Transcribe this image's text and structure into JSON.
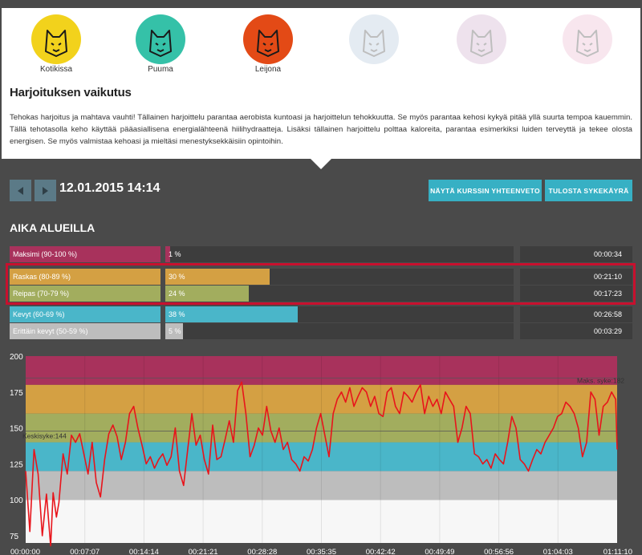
{
  "animals": [
    {
      "label": "Kotikissa",
      "color": "#f2d21c",
      "icon": "cat-icon"
    },
    {
      "label": "Puuma",
      "color": "#35c1a8",
      "icon": "puma-icon"
    },
    {
      "label": "Leijona",
      "color": "#e34a16",
      "icon": "lion-icon"
    },
    {
      "label": "",
      "color": "#9fb8d1",
      "icon": "leopard-icon"
    },
    {
      "label": "",
      "color": "#c69ac0",
      "icon": "tiger-icon"
    },
    {
      "label": "",
      "color": "#e8a7c6",
      "icon": "panther-icon"
    }
  ],
  "effect": {
    "title": "Harjoituksen vaikutus",
    "body": "Tehokas harjoitus ja mahtava vauhti! Tällainen harjoittelu parantaa aerobista kuntoasi ja harjoittelun tehokkuutta. Se myös parantaa kehosi kykyä pitää yllä suurta tempoa kauemmin. Tällä tehotasolla keho käyttää pääasiallisena energialähteenä hiilihydraatteja. Lisäksi tällainen harjoittelu polttaa kaloreita, parantaa esimerkiksi luiden terveyttä ja tekee olosta energisen. Se myös valmistaa kehoasi ja mieltäsi menestyksekkäisiin opintoihin."
  },
  "toolbar": {
    "date": "12.01.2015 14:14",
    "summary_label": "NÄYTÄ KURSSIN YHTEENVETO",
    "print_label": "TULOSTA SYKEKÄYRÄ"
  },
  "zones_title": "AIKA ALUEILLA",
  "zones": [
    {
      "name": "Maksimi (90-100 %)",
      "pct": "1 %",
      "fraction": 0.01,
      "time": "00:00:34",
      "color": "#a8325c"
    },
    {
      "name": "Raskas (80-89 %)",
      "pct": "30 %",
      "fraction": 0.3,
      "time": "00:21:10",
      "color": "#d4a043"
    },
    {
      "name": "Reipas (70-79 %)",
      "pct": "24 %",
      "fraction": 0.24,
      "time": "00:17:23",
      "color": "#a2ad5e"
    },
    {
      "name": "Kevyt (60-69 %)",
      "pct": "38 %",
      "fraction": 0.38,
      "time": "00:26:58",
      "color": "#4ab6c9"
    },
    {
      "name": "Erittäin kevyt (50-59 %)",
      "pct": "5 %",
      "fraction": 0.05,
      "time": "00:03:29",
      "color": "#bdbdbd"
    }
  ],
  "chart_data": {
    "type": "line",
    "title": "",
    "xlabel": "",
    "ylabel": "",
    "ylim": [
      70,
      200
    ],
    "y_ticks": [
      "200",
      "175",
      "150",
      "125",
      "100",
      "75"
    ],
    "x_ticks": [
      "00:00:00",
      "00:07:07",
      "00:14:14",
      "00:21:21",
      "00:28:28",
      "00:35:35",
      "00:42:42",
      "00:49:49",
      "00:56:56",
      "01:04:03",
      "01:11:10"
    ],
    "bands": [
      {
        "from": 180,
        "to": 200,
        "color": "#a8325c"
      },
      {
        "from": 160,
        "to": 180,
        "color": "#d4a043"
      },
      {
        "from": 140,
        "to": 160,
        "color": "#a2ad5e"
      },
      {
        "from": 120,
        "to": 140,
        "color": "#4ab6c9"
      },
      {
        "from": 100,
        "to": 120,
        "color": "#bdbdbd"
      },
      {
        "from": 70,
        "to": 100,
        "color": "#f7f7f7"
      }
    ],
    "max_line": {
      "value": 182,
      "label": "Maks. syke:182"
    },
    "avg_line": {
      "value": 144,
      "label": "Keskisyke:144"
    },
    "line_color": "#e8141b",
    "series": [
      {
        "x_minutes": [
          0,
          0.5,
          1,
          1.5,
          2,
          2.5,
          3,
          3.3,
          3.7,
          4,
          4.5,
          5,
          5.5,
          6,
          6.5,
          7,
          7.5,
          8,
          8.5,
          9,
          9.5,
          10,
          10.5,
          11,
          11.5,
          12,
          12.5,
          13,
          13.5,
          14,
          14.5,
          15,
          15.5,
          16,
          16.5,
          17,
          17.5,
          18,
          18.5,
          19,
          19.5,
          20,
          20.5,
          21,
          21.5,
          22,
          22.5,
          23,
          23.5,
          24,
          24.5,
          25,
          25.5,
          26,
          26.5,
          27,
          27.5,
          28,
          28.5,
          29,
          29.5,
          30,
          30.5,
          31,
          31.5,
          32,
          32.5,
          33,
          33.5,
          34,
          34.5,
          35,
          35.5,
          36,
          36.5,
          37,
          37.5,
          38,
          38.5,
          39,
          39.5,
          40,
          40.5,
          41,
          41.5,
          42,
          42.5,
          43,
          43.5,
          44,
          44.5,
          45,
          45.5,
          46,
          46.5,
          47,
          47.5,
          48,
          48.5,
          49,
          49.5,
          50,
          50.5,
          51,
          51.5,
          52,
          52.5,
          53,
          53.5,
          54,
          54.5,
          55,
          55.5,
          56,
          56.5,
          57,
          57.5,
          58,
          58.5,
          59,
          59.5,
          60,
          60.5,
          61,
          61.5,
          62,
          62.5,
          63,
          63.5,
          64,
          64.5,
          65,
          65.5,
          66,
          66.5,
          67,
          67.5,
          68,
          68.5,
          69,
          69.5,
          70,
          70.5,
          71,
          71.17
        ],
        "values": [
          120,
          78,
          135,
          118,
          75,
          104,
          68,
          105,
          88,
          98,
          132,
          118,
          145,
          140,
          146,
          132,
          118,
          140,
          112,
          102,
          128,
          146,
          152,
          144,
          128,
          140,
          160,
          165,
          150,
          138,
          125,
          130,
          122,
          128,
          132,
          124,
          130,
          150,
          120,
          110,
          135,
          160,
          138,
          145,
          128,
          118,
          152,
          128,
          130,
          142,
          155,
          140,
          176,
          182,
          160,
          130,
          138,
          150,
          145,
          165,
          148,
          140,
          150,
          135,
          140,
          128,
          125,
          120,
          130,
          127,
          135,
          150,
          160,
          145,
          130,
          160,
          170,
          175,
          168,
          178,
          165,
          172,
          178,
          175,
          165,
          172,
          160,
          158,
          175,
          178,
          165,
          160,
          175,
          172,
          168,
          175,
          180,
          160,
          172,
          165,
          170,
          160,
          175,
          170,
          165,
          140,
          150,
          165,
          160,
          132,
          130,
          125,
          128,
          122,
          132,
          128,
          125,
          140,
          158,
          150,
          128,
          125,
          120,
          128,
          135,
          132,
          140,
          145,
          150,
          158,
          160,
          168,
          165,
          160,
          150,
          130,
          140,
          175,
          170,
          145,
          165,
          168,
          175,
          170,
          135,
          125,
          122
        ]
      }
    ]
  }
}
